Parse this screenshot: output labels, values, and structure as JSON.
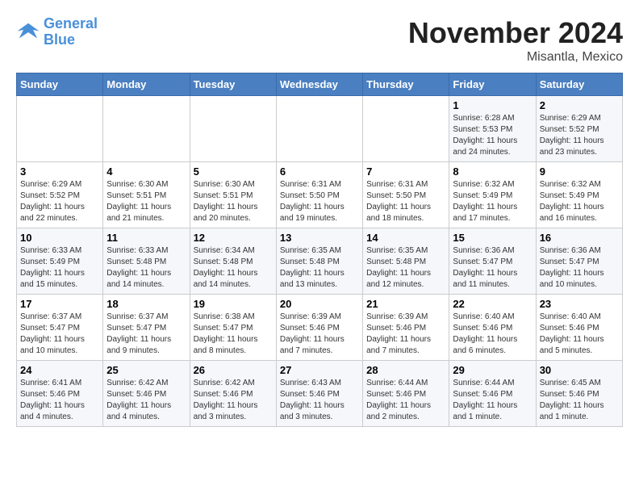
{
  "header": {
    "logo_line1": "General",
    "logo_line2": "Blue",
    "month": "November 2024",
    "location": "Misantla, Mexico"
  },
  "weekdays": [
    "Sunday",
    "Monday",
    "Tuesday",
    "Wednesday",
    "Thursday",
    "Friday",
    "Saturday"
  ],
  "weeks": [
    [
      {
        "day": "",
        "info": ""
      },
      {
        "day": "",
        "info": ""
      },
      {
        "day": "",
        "info": ""
      },
      {
        "day": "",
        "info": ""
      },
      {
        "day": "",
        "info": ""
      },
      {
        "day": "1",
        "info": "Sunrise: 6:28 AM\nSunset: 5:53 PM\nDaylight: 11 hours and 24 minutes."
      },
      {
        "day": "2",
        "info": "Sunrise: 6:29 AM\nSunset: 5:52 PM\nDaylight: 11 hours and 23 minutes."
      }
    ],
    [
      {
        "day": "3",
        "info": "Sunrise: 6:29 AM\nSunset: 5:52 PM\nDaylight: 11 hours and 22 minutes."
      },
      {
        "day": "4",
        "info": "Sunrise: 6:30 AM\nSunset: 5:51 PM\nDaylight: 11 hours and 21 minutes."
      },
      {
        "day": "5",
        "info": "Sunrise: 6:30 AM\nSunset: 5:51 PM\nDaylight: 11 hours and 20 minutes."
      },
      {
        "day": "6",
        "info": "Sunrise: 6:31 AM\nSunset: 5:50 PM\nDaylight: 11 hours and 19 minutes."
      },
      {
        "day": "7",
        "info": "Sunrise: 6:31 AM\nSunset: 5:50 PM\nDaylight: 11 hours and 18 minutes."
      },
      {
        "day": "8",
        "info": "Sunrise: 6:32 AM\nSunset: 5:49 PM\nDaylight: 11 hours and 17 minutes."
      },
      {
        "day": "9",
        "info": "Sunrise: 6:32 AM\nSunset: 5:49 PM\nDaylight: 11 hours and 16 minutes."
      }
    ],
    [
      {
        "day": "10",
        "info": "Sunrise: 6:33 AM\nSunset: 5:49 PM\nDaylight: 11 hours and 15 minutes."
      },
      {
        "day": "11",
        "info": "Sunrise: 6:33 AM\nSunset: 5:48 PM\nDaylight: 11 hours and 14 minutes."
      },
      {
        "day": "12",
        "info": "Sunrise: 6:34 AM\nSunset: 5:48 PM\nDaylight: 11 hours and 14 minutes."
      },
      {
        "day": "13",
        "info": "Sunrise: 6:35 AM\nSunset: 5:48 PM\nDaylight: 11 hours and 13 minutes."
      },
      {
        "day": "14",
        "info": "Sunrise: 6:35 AM\nSunset: 5:48 PM\nDaylight: 11 hours and 12 minutes."
      },
      {
        "day": "15",
        "info": "Sunrise: 6:36 AM\nSunset: 5:47 PM\nDaylight: 11 hours and 11 minutes."
      },
      {
        "day": "16",
        "info": "Sunrise: 6:36 AM\nSunset: 5:47 PM\nDaylight: 11 hours and 10 minutes."
      }
    ],
    [
      {
        "day": "17",
        "info": "Sunrise: 6:37 AM\nSunset: 5:47 PM\nDaylight: 11 hours and 10 minutes."
      },
      {
        "day": "18",
        "info": "Sunrise: 6:37 AM\nSunset: 5:47 PM\nDaylight: 11 hours and 9 minutes."
      },
      {
        "day": "19",
        "info": "Sunrise: 6:38 AM\nSunset: 5:47 PM\nDaylight: 11 hours and 8 minutes."
      },
      {
        "day": "20",
        "info": "Sunrise: 6:39 AM\nSunset: 5:46 PM\nDaylight: 11 hours and 7 minutes."
      },
      {
        "day": "21",
        "info": "Sunrise: 6:39 AM\nSunset: 5:46 PM\nDaylight: 11 hours and 7 minutes."
      },
      {
        "day": "22",
        "info": "Sunrise: 6:40 AM\nSunset: 5:46 PM\nDaylight: 11 hours and 6 minutes."
      },
      {
        "day": "23",
        "info": "Sunrise: 6:40 AM\nSunset: 5:46 PM\nDaylight: 11 hours and 5 minutes."
      }
    ],
    [
      {
        "day": "24",
        "info": "Sunrise: 6:41 AM\nSunset: 5:46 PM\nDaylight: 11 hours and 4 minutes."
      },
      {
        "day": "25",
        "info": "Sunrise: 6:42 AM\nSunset: 5:46 PM\nDaylight: 11 hours and 4 minutes."
      },
      {
        "day": "26",
        "info": "Sunrise: 6:42 AM\nSunset: 5:46 PM\nDaylight: 11 hours and 3 minutes."
      },
      {
        "day": "27",
        "info": "Sunrise: 6:43 AM\nSunset: 5:46 PM\nDaylight: 11 hours and 3 minutes."
      },
      {
        "day": "28",
        "info": "Sunrise: 6:44 AM\nSunset: 5:46 PM\nDaylight: 11 hours and 2 minutes."
      },
      {
        "day": "29",
        "info": "Sunrise: 6:44 AM\nSunset: 5:46 PM\nDaylight: 11 hours and 1 minute."
      },
      {
        "day": "30",
        "info": "Sunrise: 6:45 AM\nSunset: 5:46 PM\nDaylight: 11 hours and 1 minute."
      }
    ]
  ]
}
